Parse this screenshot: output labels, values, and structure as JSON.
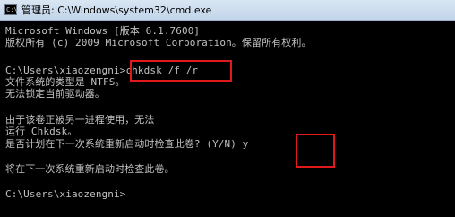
{
  "window": {
    "title": "管理员: C:\\Windows\\system32\\cmd.exe",
    "icon_text": "C:\\",
    "icon": "console-icon"
  },
  "console": {
    "lines": [
      "Microsoft Windows [版本 6.1.7600]",
      "版权所有 (c) 2009 Microsoft Corporation。保留所有权利。",
      "",
      "C:\\Users\\xiaozengni>chkdsk /f /r",
      "文件系统的类型是 NTFS。",
      "无法锁定当前驱动器。",
      "",
      "由于该卷正被另一进程使用，无法",
      "运行 Chkdsk。",
      "是否计划在下一次系统重新启动时检查此卷? (Y/N) y",
      "",
      "将在下一次系统重新启动时检查此卷。",
      "",
      "C:\\Users\\xiaozengni>"
    ]
  },
  "colors": {
    "console_text": "#c0c0c0",
    "console_bg": "#000000",
    "highlight": "#e01a1a"
  }
}
